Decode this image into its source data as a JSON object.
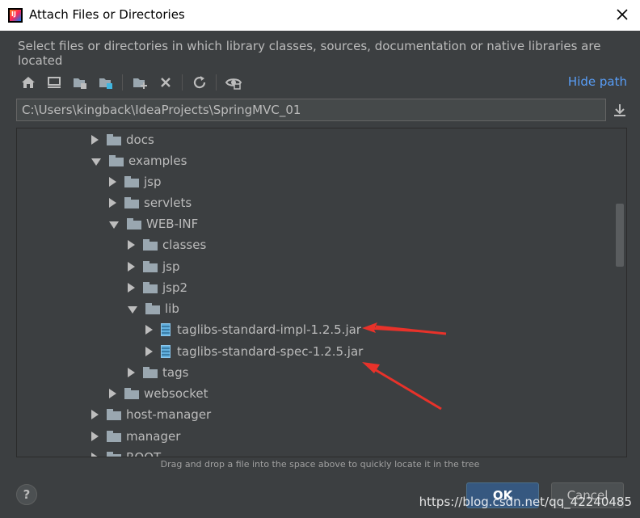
{
  "window": {
    "title": "Attach Files or Directories",
    "subtitle": "Select files or directories in which library classes, sources, documentation or native libraries are located"
  },
  "toolbar": {
    "buttons": [
      "home-icon",
      "desktop-icon",
      "project-folder-icon",
      "module-folder-icon",
      "new-folder-icon",
      "delete-icon",
      "refresh-icon",
      "show-hidden-icon"
    ],
    "hide_path_label": "Hide path"
  },
  "path_field": {
    "value": "C:\\Users\\kingback\\IdeaProjects\\SpringMVC_01"
  },
  "tree": {
    "nodes": [
      {
        "label": "docs",
        "expanded": false,
        "type": "folder"
      },
      {
        "label": "examples",
        "expanded": true,
        "type": "folder"
      },
      {
        "label": "jsp",
        "expanded": false,
        "type": "folder"
      },
      {
        "label": "servlets",
        "expanded": false,
        "type": "folder"
      },
      {
        "label": "WEB-INF",
        "expanded": true,
        "type": "folder"
      },
      {
        "label": "classes",
        "expanded": false,
        "type": "folder"
      },
      {
        "label": "jsp",
        "expanded": false,
        "type": "folder"
      },
      {
        "label": "jsp2",
        "expanded": false,
        "type": "folder"
      },
      {
        "label": "lib",
        "expanded": true,
        "type": "folder"
      },
      {
        "label": "taglibs-standard-impl-1.2.5.jar",
        "expanded": false,
        "type": "jar"
      },
      {
        "label": "taglibs-standard-spec-1.2.5.jar",
        "expanded": false,
        "type": "jar"
      },
      {
        "label": "tags",
        "expanded": false,
        "type": "folder"
      },
      {
        "label": "websocket",
        "expanded": false,
        "type": "folder"
      },
      {
        "label": "host-manager",
        "expanded": false,
        "type": "folder"
      },
      {
        "label": "manager",
        "expanded": false,
        "type": "folder"
      },
      {
        "label": "ROOT",
        "expanded": false,
        "type": "folder"
      }
    ]
  },
  "hint": "Drag and drop a file into the space above to quickly locate it in the tree",
  "buttons": {
    "help": "?",
    "ok": "OK",
    "cancel": "Cancel"
  },
  "watermark": "https://blog.csdn.net/qq_42240485",
  "colors": {
    "background": "#3c3f41",
    "accent_link": "#589df6",
    "ok_button": "#365880",
    "annotation_arrow": "#e8322a"
  }
}
